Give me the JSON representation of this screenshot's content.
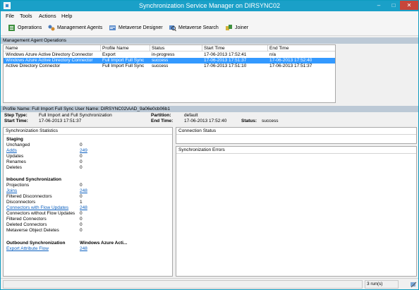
{
  "window": {
    "title": "Synchronization Service Manager on DIRSYNC02",
    "min_glyph": "–",
    "max_glyph": "□",
    "close_glyph": "✕"
  },
  "menu": [
    "File",
    "Tools",
    "Actions",
    "Help"
  ],
  "toolbar": {
    "operations": "Operations",
    "management_agents": "Management Agents",
    "metaverse_designer": "Metaverse Designer",
    "metaverse_search": "Metaverse Search",
    "joiner": "Joiner"
  },
  "operations": {
    "section_title": "Management Agent Operations",
    "columns": [
      "Name",
      "Profile Name",
      "Status",
      "Start Time",
      "End Time"
    ],
    "rows": [
      {
        "name": "Windows Azure Active Directory Connector",
        "profile": "Export",
        "status": "in-progress",
        "start": "17-06-2013 17:52:41",
        "end": "n/a",
        "selected": false
      },
      {
        "name": "Windows Azure Active Directory Connector",
        "profile": "Full Import Full Sync",
        "status": "success",
        "start": "17-06-2013 17:51:37",
        "end": "17-06-2013 17:52:40",
        "selected": true
      },
      {
        "name": "Active Directory Connector",
        "profile": "Full Import Full Sync",
        "status": "success",
        "start": "17-06-2013 17:51:10",
        "end": "17-06-2013 17:51:37",
        "selected": false
      }
    ]
  },
  "profile_bar": "Profile Name: Full Import Full Sync  User Name: DIRSYNC02\\AAD_9a06e0cb06b1",
  "summary": {
    "step_type_label": "Step Type:",
    "step_type": "Full Import and Full Synchronization",
    "start_time_label": "Start Time:",
    "start_time": "17-06-2013 17:51:37",
    "partition_label": "Partition:",
    "partition": "default",
    "end_time_label": "End Time:",
    "end_time": "17-06-2013 17:52:40",
    "status_label": "Status:",
    "status": "success"
  },
  "stats": {
    "title": "Synchronization Statistics",
    "staging_title": "Staging",
    "unchanged_label": "Unchanged",
    "unchanged": "0",
    "adds_label": "Adds",
    "adds": "249",
    "updates_label": "Updates",
    "updates": "0",
    "renames_label": "Renames",
    "renames": "0",
    "deletes_label": "Deletes",
    "deletes": "0",
    "inbound_title": "Inbound Synchronization",
    "projections_label": "Projections",
    "projections": "0",
    "joins_label": "Joins",
    "joins": "248",
    "filtered_disc_label": "Filtered Disconnectors",
    "filtered_disc": "0",
    "disconnectors_label": "Disconnectors",
    "disconnectors": "1",
    "conn_flow_label": "Connectors with Flow Updates",
    "conn_flow": "248",
    "conn_noflow_label": "Connectors without Flow Updates",
    "conn_noflow": "0",
    "filtered_conn_label": "Filtered Connectors",
    "filtered_conn": "0",
    "deleted_conn_label": "Deleted Connectors",
    "deleted_conn": "0",
    "mv_deletes_label": "Metaverse Object Deletes",
    "mv_deletes": "0",
    "outbound_title": "Outbound Synchronization",
    "outbound_target": "Windows Azure Acti...",
    "export_flow_label": "Export Attribute Flow",
    "export_flow": "248"
  },
  "connection_status": {
    "title": "Connection Status"
  },
  "sync_errors": {
    "title": "Synchronization Errors"
  },
  "statusbar": {
    "runs": "3 run(s)"
  },
  "colors": {
    "title_bar": "#1aa0c8",
    "section_bar": "#bcc9d6",
    "selection": "#3399ff",
    "link": "#0b5fbf",
    "close": "#c7463a"
  },
  "icons": [
    "app-icon",
    "operations-icon",
    "management-agents-icon",
    "metaverse-designer-icon",
    "metaverse-search-icon",
    "joiner-icon",
    "status-grip-icon"
  ]
}
